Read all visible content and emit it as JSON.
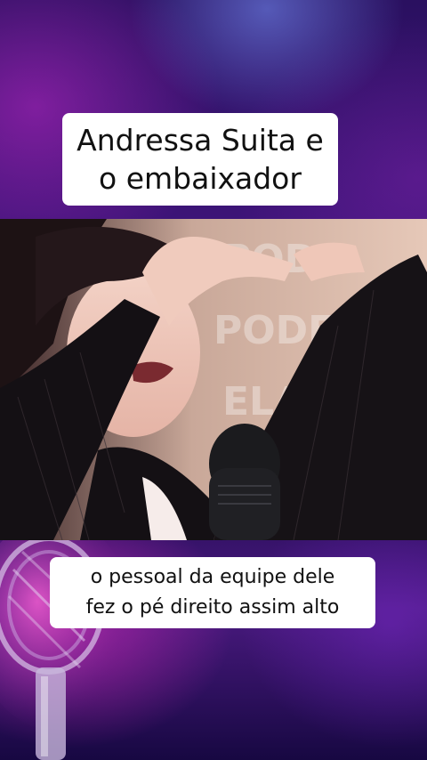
{
  "overlay_title": {
    "text": "Andressa Suita e\no embaixador"
  },
  "caption": {
    "text": "o pessoal da equipe dele\nfez o pé direito assim alto"
  },
  "video": {
    "background_watermark": "PODELAS"
  },
  "colors": {
    "background_top": "#2a1060",
    "background_glow": "#be28c8",
    "text_box": "#ffffff",
    "text": "#111111"
  }
}
